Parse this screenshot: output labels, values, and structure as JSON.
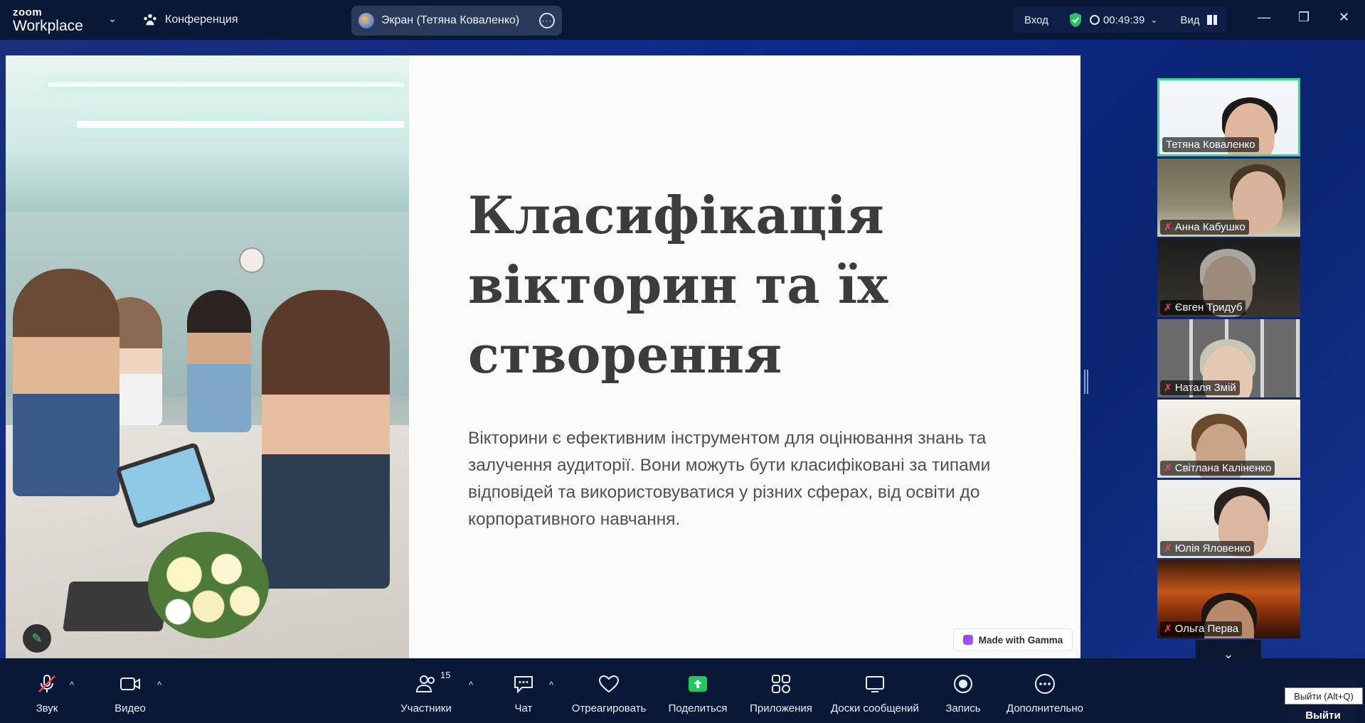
{
  "app": {
    "logo_top": "zoom",
    "logo_bottom": "Workplace",
    "conference_label": "Конференция",
    "screen_share_label": "Экран (Тетяна  Коваленко)",
    "signin_label": "Вход",
    "timer": "00:49:39",
    "view_label": "Вид"
  },
  "slide": {
    "title": "Класифікація вікторин та їх створення",
    "body": "Вікторини є ефективним інструментом для оцінювання знань та залучення аудиторії. Вони можуть бути класифіковані за типами відповідей та використовуватися у різних сферах, від освіти до корпоративного навчання.",
    "badge": "Made with Gamma"
  },
  "participants": [
    {
      "name": "Тетяна  Коваленко",
      "muted": false,
      "active": true
    },
    {
      "name": "Анна Кабушко",
      "muted": true,
      "active": false
    },
    {
      "name": "Євген Тридуб",
      "muted": true,
      "active": false
    },
    {
      "name": "Наталя Змій",
      "muted": true,
      "active": false
    },
    {
      "name": "Світлана Каліненко",
      "muted": true,
      "active": false
    },
    {
      "name": "Юлія Яловенко",
      "muted": true,
      "active": false
    },
    {
      "name": "Ольга Перва",
      "muted": true,
      "active": false
    }
  ],
  "toolbar": {
    "audio": "Звук",
    "video": "Видео",
    "participants": "Участники",
    "participants_count": "15",
    "chat": "Чат",
    "react": "Отреагировать",
    "share": "Поделиться",
    "apps": "Приложения",
    "whiteboards": "Доски сообщений",
    "record": "Запись",
    "more": "Дополнительно",
    "leave": "Выйти",
    "leave_tooltip": "Выйти (Alt+Q)"
  },
  "colors": {
    "topbar": "#0a1838",
    "share_green": "#2fe08a",
    "muted_red": "#ff4a4a"
  }
}
